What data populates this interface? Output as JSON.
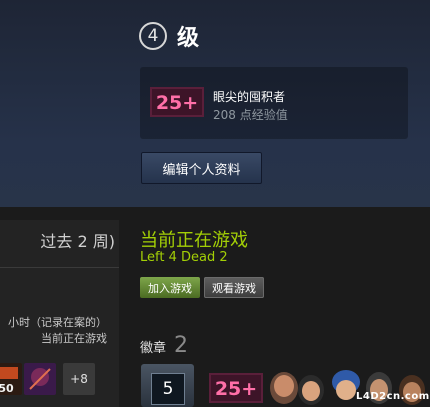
{
  "header": {
    "level_number": "4",
    "level_word": "级",
    "badge": {
      "label": "25+",
      "name": "眼尖的囤积者",
      "xp": "208 点经验值"
    },
    "edit_button": "编辑个人资料"
  },
  "recent": {
    "title": "过去 2 周)",
    "hours_text": "小时（记录在案的）",
    "in_game_text": "当前正在游戏",
    "more_count": "+8"
  },
  "status": {
    "title": "当前正在游戏",
    "game": "Left 4 Dead 2",
    "join_button": "加入游戏",
    "view_button": "观看游戏"
  },
  "badges": {
    "label": "徽章",
    "count": "2",
    "years_number": "5",
    "badge2_label": "25+"
  },
  "watermark": {
    "text": "L4D2cn.com"
  },
  "colors": {
    "accent_green": "#a3cf06",
    "badge_pink": "#e8387a",
    "header_bg": "#26324a"
  }
}
